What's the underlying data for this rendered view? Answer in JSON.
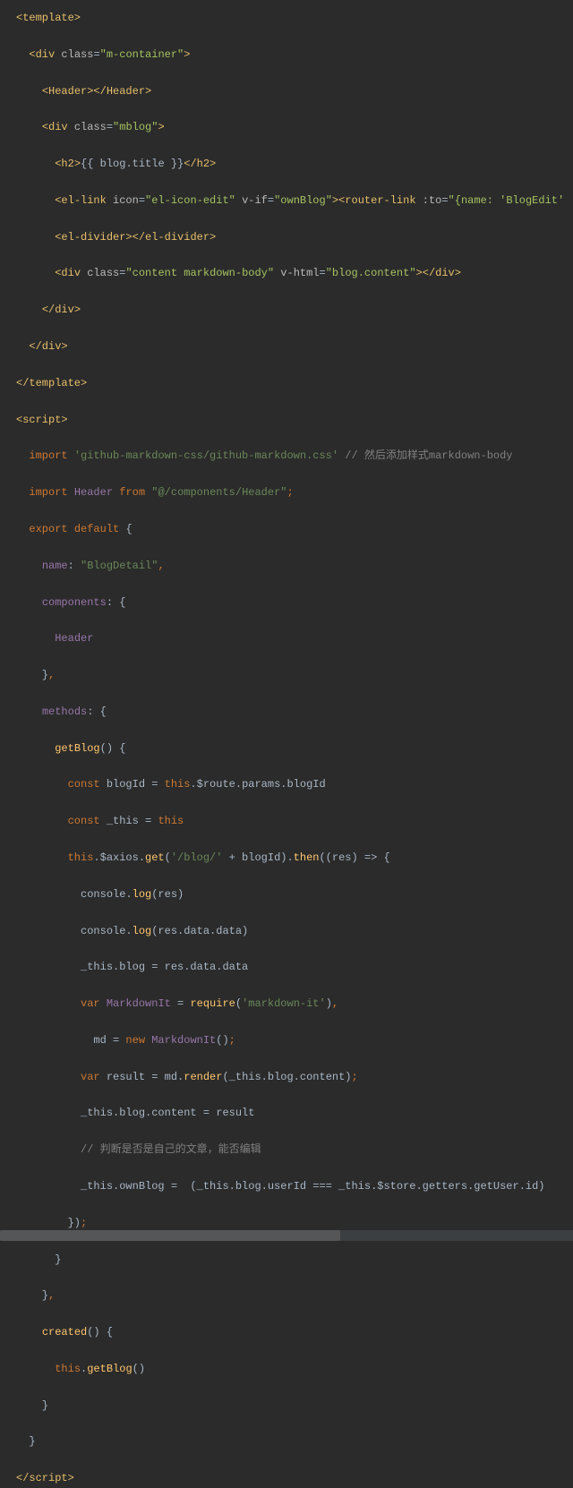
{
  "lines": [
    {
      "segments": [
        {
          "t": "<template>",
          "c": "tag"
        }
      ]
    },
    {
      "segments": []
    },
    {
      "segments": [
        {
          "t": "  ",
          "c": "identifier"
        },
        {
          "t": "<div ",
          "c": "tag"
        },
        {
          "t": "class",
          "c": "attr-name"
        },
        {
          "t": "=",
          "c": "punct"
        },
        {
          "t": "\"m-container\"",
          "c": "attr-value"
        },
        {
          "t": ">",
          "c": "tag"
        }
      ]
    },
    {
      "segments": []
    },
    {
      "segments": [
        {
          "t": "    ",
          "c": "identifier"
        },
        {
          "t": "<Header></Header>",
          "c": "tag"
        }
      ]
    },
    {
      "segments": []
    },
    {
      "segments": [
        {
          "t": "    ",
          "c": "identifier"
        },
        {
          "t": "<div ",
          "c": "tag"
        },
        {
          "t": "class",
          "c": "attr-name"
        },
        {
          "t": "=",
          "c": "punct"
        },
        {
          "t": "\"mblog\"",
          "c": "attr-value"
        },
        {
          "t": ">",
          "c": "tag"
        }
      ]
    },
    {
      "segments": []
    },
    {
      "segments": [
        {
          "t": "      ",
          "c": "identifier"
        },
        {
          "t": "<h2>",
          "c": "tag"
        },
        {
          "t": "{{ blog.title }}",
          "c": "identifier"
        },
        {
          "t": "</h2>",
          "c": "tag"
        }
      ]
    },
    {
      "segments": []
    },
    {
      "segments": [
        {
          "t": "      ",
          "c": "identifier"
        },
        {
          "t": "<el-link ",
          "c": "tag"
        },
        {
          "t": "icon",
          "c": "attr-name"
        },
        {
          "t": "=",
          "c": "punct"
        },
        {
          "t": "\"el-icon-edit\"",
          "c": "attr-value"
        },
        {
          "t": " ",
          "c": "identifier"
        },
        {
          "t": "v-if",
          "c": "attr-name"
        },
        {
          "t": "=",
          "c": "punct"
        },
        {
          "t": "\"ownBlog\"",
          "c": "attr-value"
        },
        {
          "t": "><router-link ",
          "c": "tag"
        },
        {
          "t": ":to",
          "c": "attr-name"
        },
        {
          "t": "=",
          "c": "punct"
        },
        {
          "t": "\"{name: 'BlogEdit'",
          "c": "attr-value"
        }
      ]
    },
    {
      "segments": []
    },
    {
      "segments": [
        {
          "t": "      ",
          "c": "identifier"
        },
        {
          "t": "<el-divider></el-divider>",
          "c": "tag"
        }
      ]
    },
    {
      "segments": []
    },
    {
      "segments": [
        {
          "t": "      ",
          "c": "identifier"
        },
        {
          "t": "<div ",
          "c": "tag"
        },
        {
          "t": "class",
          "c": "attr-name"
        },
        {
          "t": "=",
          "c": "punct"
        },
        {
          "t": "\"content markdown-body\"",
          "c": "attr-value"
        },
        {
          "t": " ",
          "c": "identifier"
        },
        {
          "t": "v-html",
          "c": "attr-name"
        },
        {
          "t": "=",
          "c": "punct"
        },
        {
          "t": "\"blog.content\"",
          "c": "attr-value"
        },
        {
          "t": "></div>",
          "c": "tag"
        }
      ]
    },
    {
      "segments": []
    },
    {
      "segments": [
        {
          "t": "    ",
          "c": "identifier"
        },
        {
          "t": "</div>",
          "c": "tag"
        }
      ]
    },
    {
      "segments": []
    },
    {
      "segments": [
        {
          "t": "  ",
          "c": "identifier"
        },
        {
          "t": "</div>",
          "c": "tag"
        }
      ]
    },
    {
      "segments": []
    },
    {
      "segments": [
        {
          "t": "</template>",
          "c": "tag"
        }
      ]
    },
    {
      "segments": []
    },
    {
      "segments": [
        {
          "t": "<script>",
          "c": "tag"
        }
      ]
    },
    {
      "segments": []
    },
    {
      "segments": [
        {
          "t": "  ",
          "c": "identifier"
        },
        {
          "t": "import ",
          "c": "keyword"
        },
        {
          "t": "'github-markdown-css/github-markdown.css'",
          "c": "string"
        },
        {
          "t": " // 然后添加样式markdown-body",
          "c": "comment"
        }
      ]
    },
    {
      "segments": []
    },
    {
      "segments": [
        {
          "t": "  ",
          "c": "identifier"
        },
        {
          "t": "import ",
          "c": "keyword"
        },
        {
          "t": "Header ",
          "c": "property"
        },
        {
          "t": "from ",
          "c": "keyword"
        },
        {
          "t": "\"@/components/Header\"",
          "c": "string"
        },
        {
          "t": ";",
          "c": "keyword"
        }
      ]
    },
    {
      "segments": []
    },
    {
      "segments": [
        {
          "t": "  ",
          "c": "identifier"
        },
        {
          "t": "export default ",
          "c": "keyword"
        },
        {
          "t": "{",
          "c": "identifier"
        }
      ]
    },
    {
      "segments": []
    },
    {
      "segments": [
        {
          "t": "    ",
          "c": "identifier"
        },
        {
          "t": "name",
          "c": "property"
        },
        {
          "t": ": ",
          "c": "identifier"
        },
        {
          "t": "\"BlogDetail\"",
          "c": "string"
        },
        {
          "t": ",",
          "c": "keyword"
        }
      ]
    },
    {
      "segments": []
    },
    {
      "segments": [
        {
          "t": "    ",
          "c": "identifier"
        },
        {
          "t": "components",
          "c": "property"
        },
        {
          "t": ": {",
          "c": "identifier"
        }
      ]
    },
    {
      "segments": []
    },
    {
      "segments": [
        {
          "t": "      ",
          "c": "identifier"
        },
        {
          "t": "Header",
          "c": "property"
        }
      ]
    },
    {
      "segments": []
    },
    {
      "segments": [
        {
          "t": "    }",
          "c": "identifier"
        },
        {
          "t": ",",
          "c": "keyword"
        }
      ]
    },
    {
      "segments": []
    },
    {
      "segments": [
        {
          "t": "    ",
          "c": "identifier"
        },
        {
          "t": "methods",
          "c": "property"
        },
        {
          "t": ": {",
          "c": "identifier"
        }
      ]
    },
    {
      "segments": []
    },
    {
      "segments": [
        {
          "t": "      ",
          "c": "identifier"
        },
        {
          "t": "getBlog",
          "c": "func"
        },
        {
          "t": "() {",
          "c": "identifier"
        }
      ]
    },
    {
      "segments": []
    },
    {
      "segments": [
        {
          "t": "        ",
          "c": "identifier"
        },
        {
          "t": "const ",
          "c": "keyword"
        },
        {
          "t": "blogId = ",
          "c": "identifier"
        },
        {
          "t": "this",
          "c": "this"
        },
        {
          "t": ".$route.params.blogId",
          "c": "identifier"
        }
      ]
    },
    {
      "segments": []
    },
    {
      "segments": [
        {
          "t": "        ",
          "c": "identifier"
        },
        {
          "t": "const ",
          "c": "keyword"
        },
        {
          "t": "_this = ",
          "c": "identifier"
        },
        {
          "t": "this",
          "c": "this"
        }
      ]
    },
    {
      "segments": []
    },
    {
      "segments": [
        {
          "t": "        ",
          "c": "identifier"
        },
        {
          "t": "this",
          "c": "this"
        },
        {
          "t": ".$axios.",
          "c": "identifier"
        },
        {
          "t": "get",
          "c": "func"
        },
        {
          "t": "(",
          "c": "identifier"
        },
        {
          "t": "'/blog/'",
          "c": "string"
        },
        {
          "t": " + blogId).",
          "c": "identifier"
        },
        {
          "t": "then",
          "c": "func"
        },
        {
          "t": "((res) => {",
          "c": "identifier"
        }
      ]
    },
    {
      "segments": []
    },
    {
      "segments": [
        {
          "t": "          console.",
          "c": "identifier"
        },
        {
          "t": "log",
          "c": "func"
        },
        {
          "t": "(res)",
          "c": "identifier"
        }
      ]
    },
    {
      "segments": []
    },
    {
      "segments": [
        {
          "t": "          console.",
          "c": "identifier"
        },
        {
          "t": "log",
          "c": "func"
        },
        {
          "t": "(res.data.data)",
          "c": "identifier"
        }
      ]
    },
    {
      "segments": []
    },
    {
      "segments": [
        {
          "t": "          _this.blog = res.data.data",
          "c": "identifier"
        }
      ]
    },
    {
      "segments": []
    },
    {
      "segments": [
        {
          "t": "          ",
          "c": "identifier"
        },
        {
          "t": "var ",
          "c": "keyword"
        },
        {
          "t": "MarkdownIt ",
          "c": "property"
        },
        {
          "t": "= ",
          "c": "identifier"
        },
        {
          "t": "require",
          "c": "func"
        },
        {
          "t": "(",
          "c": "identifier"
        },
        {
          "t": "'markdown-it'",
          "c": "string"
        },
        {
          "t": ")",
          "c": "identifier"
        },
        {
          "t": ",",
          "c": "keyword"
        }
      ]
    },
    {
      "segments": []
    },
    {
      "segments": [
        {
          "t": "            md = ",
          "c": "identifier"
        },
        {
          "t": "new ",
          "c": "keyword"
        },
        {
          "t": "MarkdownIt",
          "c": "property"
        },
        {
          "t": "()",
          "c": "identifier"
        },
        {
          "t": ";",
          "c": "keyword"
        }
      ]
    },
    {
      "segments": []
    },
    {
      "segments": [
        {
          "t": "          ",
          "c": "identifier"
        },
        {
          "t": "var ",
          "c": "keyword"
        },
        {
          "t": "result = md.",
          "c": "identifier"
        },
        {
          "t": "render",
          "c": "func"
        },
        {
          "t": "(_this.blog.content)",
          "c": "identifier"
        },
        {
          "t": ";",
          "c": "keyword"
        }
      ]
    },
    {
      "segments": []
    },
    {
      "segments": [
        {
          "t": "          _this.blog.content = result",
          "c": "identifier"
        }
      ]
    },
    {
      "segments": []
    },
    {
      "segments": [
        {
          "t": "          ",
          "c": "identifier"
        },
        {
          "t": "// 判断是否是自己的文章，能否编辑",
          "c": "comment"
        }
      ]
    },
    {
      "segments": []
    },
    {
      "segments": [
        {
          "t": "          _this.ownBlog =  (_this.blog.userId === _this.$store.getters.getUser.id)",
          "c": "identifier"
        }
      ]
    },
    {
      "segments": []
    },
    {
      "segments": [
        {
          "t": "        })",
          "c": "identifier"
        },
        {
          "t": ";",
          "c": "keyword"
        }
      ]
    },
    {
      "segments": []
    },
    {
      "segments": [
        {
          "t": "      }",
          "c": "identifier"
        }
      ]
    },
    {
      "segments": []
    },
    {
      "segments": [
        {
          "t": "    }",
          "c": "identifier"
        },
        {
          "t": ",",
          "c": "keyword"
        }
      ]
    },
    {
      "segments": []
    },
    {
      "segments": [
        {
          "t": "    ",
          "c": "identifier"
        },
        {
          "t": "created",
          "c": "func"
        },
        {
          "t": "() {",
          "c": "identifier"
        }
      ]
    },
    {
      "segments": []
    },
    {
      "segments": [
        {
          "t": "      ",
          "c": "identifier"
        },
        {
          "t": "this",
          "c": "this"
        },
        {
          "t": ".",
          "c": "identifier"
        },
        {
          "t": "getBlog",
          "c": "func"
        },
        {
          "t": "()",
          "c": "identifier"
        }
      ]
    },
    {
      "segments": []
    },
    {
      "segments": [
        {
          "t": "    }",
          "c": "identifier"
        }
      ]
    },
    {
      "segments": []
    },
    {
      "segments": [
        {
          "t": "  }",
          "c": "identifier"
        }
      ]
    },
    {
      "segments": []
    },
    {
      "segments": [
        {
          "t": "</script>",
          "c": "tag"
        }
      ]
    }
  ]
}
